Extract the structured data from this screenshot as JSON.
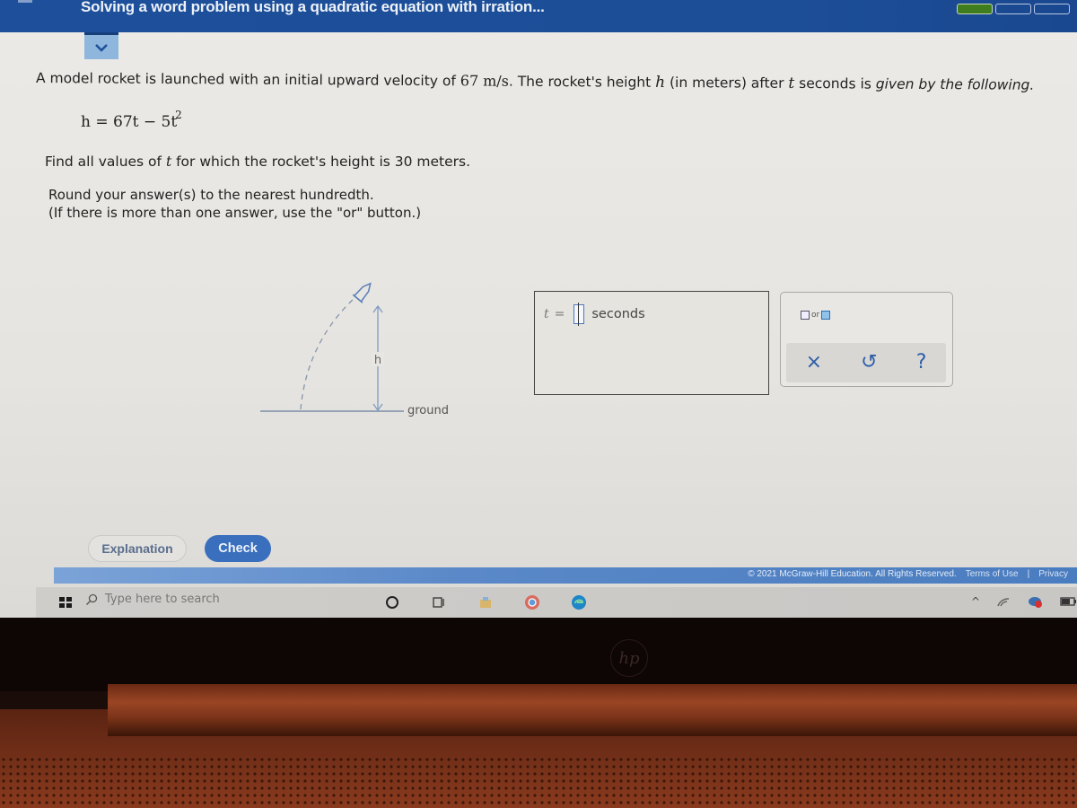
{
  "header": {
    "title": "Solving a word problem using a quadratic equation with irration...",
    "progress": {
      "segments_total": 3,
      "segments_filled": 1
    },
    "colors": {
      "bar": "#1d4f9a",
      "progress_fill": "#3f7d1e"
    }
  },
  "collapse_button": {
    "icon": "chevron-down-icon"
  },
  "question": {
    "intro_a": "A model rocket is launched with an initial upward velocity of ",
    "velocity_value": "67",
    "velocity_unit": "m/s",
    "intro_b": ". The rocket's height ",
    "var_h": "h",
    "intro_c": " (in meters) after ",
    "var_t": "t",
    "intro_d": " seconds is ",
    "intro_e": "given by the following.",
    "equation_main": "h = 67t − 5t",
    "equation_exponent": "2",
    "find_a": "Find all values of ",
    "find_var": "t",
    "find_b": " for which the rocket's height is 30 meters.",
    "round_line1": "Round your answer(s) to the nearest hundredth.",
    "round_line2": "(If there is more than one answer, use the \"or\" button.)"
  },
  "diagram": {
    "height_label": "h",
    "ground_label": "ground"
  },
  "answer": {
    "variable": "t",
    "equals": "=",
    "value": "",
    "unit": "seconds"
  },
  "tools": {
    "or_label": "or",
    "clear_symbol": "×",
    "undo_symbol": "↺",
    "help_symbol": "?"
  },
  "buttons": {
    "explanation": "Explanation",
    "check": "Check"
  },
  "footer": {
    "copyright": "© 2021 McGraw-Hill Education. All Rights Reserved.",
    "terms": "Terms of Use",
    "separator": "|",
    "privacy": "Privacy"
  },
  "taskbar": {
    "search_placeholder": "Type here to search"
  },
  "laptop": {
    "brand": "hp"
  }
}
